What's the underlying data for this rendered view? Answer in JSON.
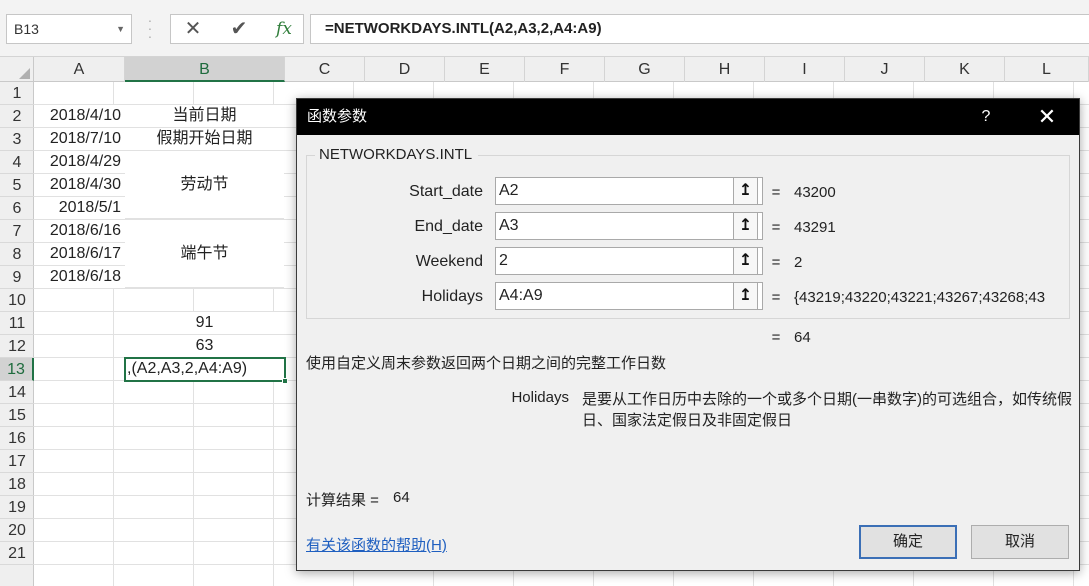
{
  "formula_bar": {
    "name_box": "B13",
    "cancel_glyph": "✕",
    "enter_glyph": "✔",
    "fx_label": "fx",
    "formula": "=NETWORKDAYS.INTL(A2,A3,2,A4:A9)"
  },
  "sheet": {
    "columns": [
      "A",
      "B",
      "C",
      "D",
      "E",
      "F",
      "G",
      "H",
      "I",
      "J",
      "K",
      "L"
    ],
    "selected_column": "B",
    "rows": [
      "1",
      "2",
      "3",
      "4",
      "5",
      "6",
      "7",
      "8",
      "9",
      "10",
      "11",
      "12",
      "13",
      "14",
      "15",
      "16",
      "17",
      "18",
      "19",
      "20",
      "21"
    ],
    "selected_row": "13",
    "colA": {
      "r2": "2018/4/10",
      "r3": "2018/7/10",
      "r4": "2018/4/29",
      "r5": "2018/4/30",
      "r6": "2018/5/1",
      "r7": "2018/6/16",
      "r8": "2018/6/17",
      "r9": "2018/6/18"
    },
    "colB": {
      "r2": "当前日期",
      "r3": "假期开始日期",
      "r4_6_merged": "劳动节",
      "r7_9_merged": "端午节",
      "r11": "91",
      "r12": "63",
      "r13_editing": ",(A2,A3,2,A4:A9)"
    }
  },
  "dialog": {
    "title": "函数参数",
    "help_glyph": "?",
    "close_glyph": "✕",
    "function_name": "NETWORKDAYS.INTL",
    "arguments": [
      {
        "label": "Start_date",
        "input": "A2",
        "value": "43200"
      },
      {
        "label": "End_date",
        "input": "A3",
        "value": "43291"
      },
      {
        "label": "Weekend",
        "input": "2",
        "value": "2"
      },
      {
        "label": "Holidays",
        "input": "A4:A9",
        "value": "{43219;43220;43221;43267;43268;43"
      }
    ],
    "collapse_glyph": "↥",
    "equals": "=",
    "formula_result": "64",
    "description": "使用自定义周末参数返回两个日期之间的完整工作日数",
    "arg_help_name": "Holidays",
    "arg_help_text": "是要从工作日历中去除的一个或多个日期(一串数字)的可选组合，如传统假日、国家法定假日及非固定假日",
    "result_label": "计算结果 =",
    "result_value": "64",
    "help_link": "有关该函数的帮助(H)",
    "ok_label": "确定",
    "cancel_label": "取消"
  },
  "colors": {
    "excel_green": "#217346",
    "dialog_title_bg": "#000000",
    "link_blue": "#1f5fc0",
    "ok_border": "#3b6fb6"
  }
}
